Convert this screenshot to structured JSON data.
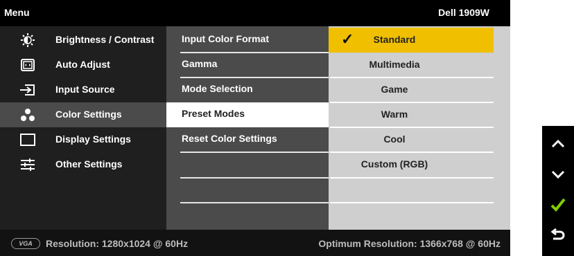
{
  "header": {
    "menu_title": "Menu",
    "model": "Dell 1909W"
  },
  "sidebar": {
    "items": [
      {
        "label": "Brightness / Contrast",
        "icon": "brightness-icon"
      },
      {
        "label": "Auto Adjust",
        "icon": "auto-adjust-icon"
      },
      {
        "label": "Input Source",
        "icon": "input-source-icon"
      },
      {
        "label": "Color Settings",
        "icon": "color-settings-icon",
        "selected": true
      },
      {
        "label": "Display Settings",
        "icon": "display-settings-icon"
      },
      {
        "label": "Other Settings",
        "icon": "other-settings-icon"
      }
    ]
  },
  "submenu": {
    "items": [
      {
        "label": "Input Color Format"
      },
      {
        "label": "Gamma"
      },
      {
        "label": "Mode Selection"
      },
      {
        "label": "Preset Modes",
        "selected": true
      },
      {
        "label": "Reset Color Settings"
      }
    ]
  },
  "options": {
    "items": [
      {
        "label": "Standard",
        "selected": true
      },
      {
        "label": "Multimedia"
      },
      {
        "label": "Game"
      },
      {
        "label": "Warm"
      },
      {
        "label": "Cool"
      },
      {
        "label": "Custom (RGB)"
      }
    ]
  },
  "footer": {
    "badge": "VGA",
    "resolution": "Resolution: 1280x1024 @ 60Hz",
    "optimum": "Optimum Resolution: 1366x768 @ 60Hz"
  },
  "buttons": [
    "up-arrow-icon",
    "down-arrow-icon",
    "check-icon",
    "back-icon"
  ],
  "colors": {
    "accent": "#f0c000",
    "check_green": "#7fd000",
    "selected_sidebar": "#4b4b4b"
  }
}
